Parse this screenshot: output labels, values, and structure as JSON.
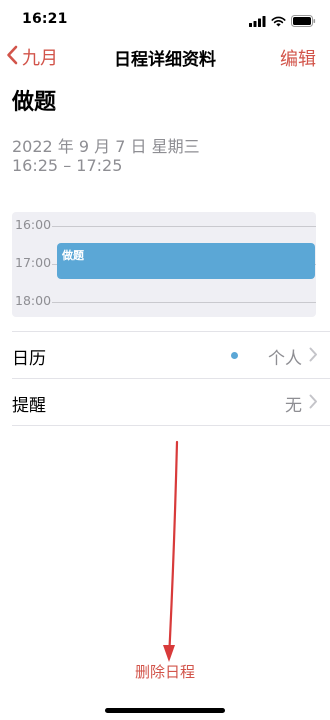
{
  "status_bar": {
    "time": "16:21"
  },
  "nav": {
    "back_label": "九月",
    "title": "日程详细资料",
    "edit_label": "编辑"
  },
  "event": {
    "title": "做题",
    "date": "2022 年 9 月 7 日  星期三",
    "time_range": "16:25 – 17:25"
  },
  "timeline": {
    "hours": [
      "16:00",
      "17:00",
      "18:00"
    ],
    "event_label": "做题"
  },
  "settings": {
    "calendar": {
      "label": "日历",
      "value": "个人",
      "dot_color": "#5ba7d6"
    },
    "alert": {
      "label": "提醒",
      "value": "无"
    }
  },
  "delete_label": "删除日程",
  "colors": {
    "accent": "#d2544a",
    "event": "#5ba7d6",
    "secondary_text": "#8e8e93",
    "annotation_arrow": "#d83a3a"
  },
  "icons": {
    "signal": "signal-icon",
    "wifi": "wifi-icon",
    "battery": "battery-icon",
    "back": "chevron-left-icon",
    "row_chevron": "chevron-right-icon"
  }
}
